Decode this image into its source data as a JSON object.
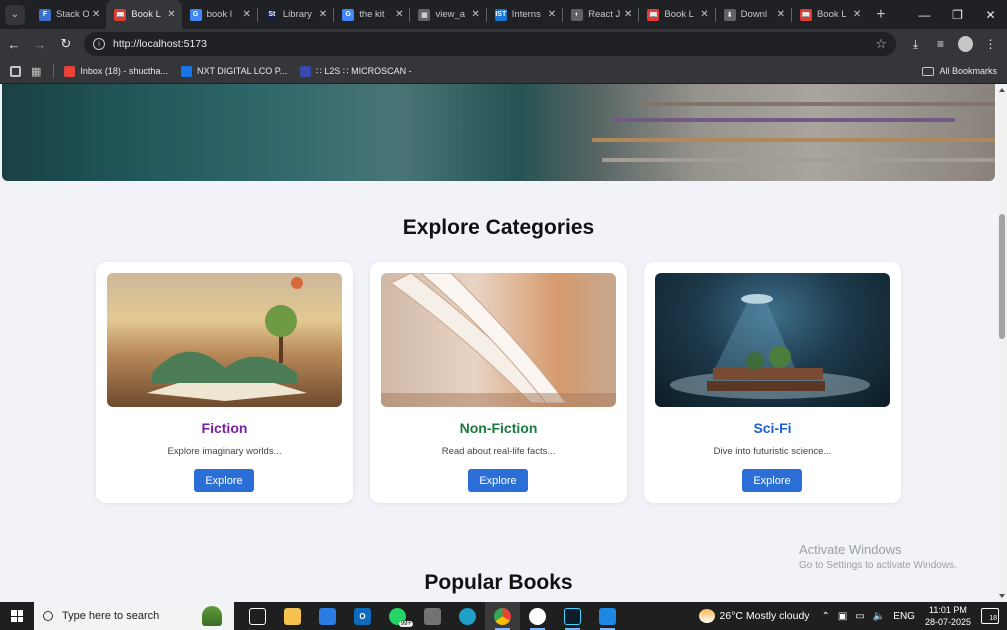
{
  "browser": {
    "tabs": [
      {
        "title": "Stack O",
        "favicon_color": "#3b71ca",
        "favicon_glyph": "F"
      },
      {
        "title": "Book L",
        "favicon_color": "#e03c31",
        "favicon_glyph": "📖",
        "active": true
      },
      {
        "title": "book l",
        "favicon_color": "#4285f4",
        "favicon_glyph": "G"
      },
      {
        "title": "Library",
        "favicon_color": "#17213a",
        "favicon_glyph": "St"
      },
      {
        "title": "the kit",
        "favicon_color": "#4285f4",
        "favicon_glyph": "G"
      },
      {
        "title": "view_a",
        "favicon_color": "#5f6368",
        "favicon_glyph": "▦"
      },
      {
        "title": "Interns",
        "favicon_color": "#1976d2",
        "favicon_glyph": "IST"
      },
      {
        "title": "React J",
        "favicon_color": "#5f6368",
        "favicon_glyph": "◐"
      },
      {
        "title": "Book L",
        "favicon_color": "#e03c31",
        "favicon_glyph": "📖"
      },
      {
        "title": "Downl",
        "favicon_color": "#5f6368",
        "favicon_glyph": "⬇"
      },
      {
        "title": "Book L",
        "favicon_color": "#e03c31",
        "favicon_glyph": "📖"
      }
    ],
    "url": "http://localhost:5173",
    "bookmarks": [
      {
        "label": "Inbox (18) - shuctha...",
        "color": "#ea4335"
      },
      {
        "label": "NXT DIGITAL LCO P...",
        "color": "#1a73e8"
      },
      {
        "label": "∷ L2S ∷ MICROSCAN -",
        "color": "#3949ab"
      }
    ],
    "all_bookmarks_label": "All Bookmarks"
  },
  "page": {
    "categories_title": "Explore Categories",
    "categories": [
      {
        "title": "Fiction",
        "description": "Explore imaginary worlds...",
        "button": "Explore",
        "title_color": "#7b1fa2"
      },
      {
        "title": "Non-Fiction",
        "description": "Read about real-life facts...",
        "button": "Explore",
        "title_color": "#1b7a3e"
      },
      {
        "title": "Sci-Fi",
        "description": "Dive into futuristic science...",
        "button": "Explore",
        "title_color": "#1f5fd0"
      }
    ],
    "popular_title": "Popular Books"
  },
  "watermark": {
    "line1": "Activate Windows",
    "line2": "Go to Settings to activate Windows."
  },
  "taskbar": {
    "search_placeholder": "Type here to search",
    "whatsapp_badge": "99+",
    "weather": "26°C  Mostly cloudy",
    "language": "ENG",
    "time": "11:01 PM",
    "date": "28-07-2025",
    "notifications": "18"
  }
}
